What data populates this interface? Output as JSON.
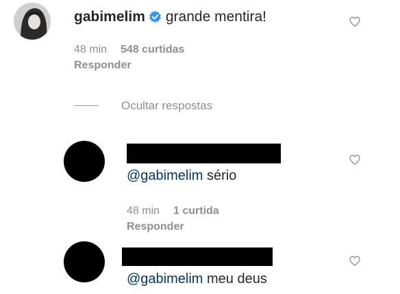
{
  "comment": {
    "username": "gabimelim",
    "text": "grande mentira!",
    "time": "48 min",
    "likes": "548 curtidas",
    "reply_label": "Responder"
  },
  "hide_replies_label": "Ocultar respostas",
  "replies": [
    {
      "mention": "@gabimelim",
      "text": "sério",
      "time": "48 min",
      "likes": "1 curtida",
      "reply_label": "Responder"
    },
    {
      "mention": "@gabimelim",
      "text": "meu deus"
    }
  ],
  "icons": {
    "verified": "verified-badge-icon",
    "like": "heart-outline-icon"
  },
  "colors": {
    "text": "#262626",
    "muted": "#8e8e8e",
    "mention": "#003569",
    "verified": "#3897f0"
  }
}
